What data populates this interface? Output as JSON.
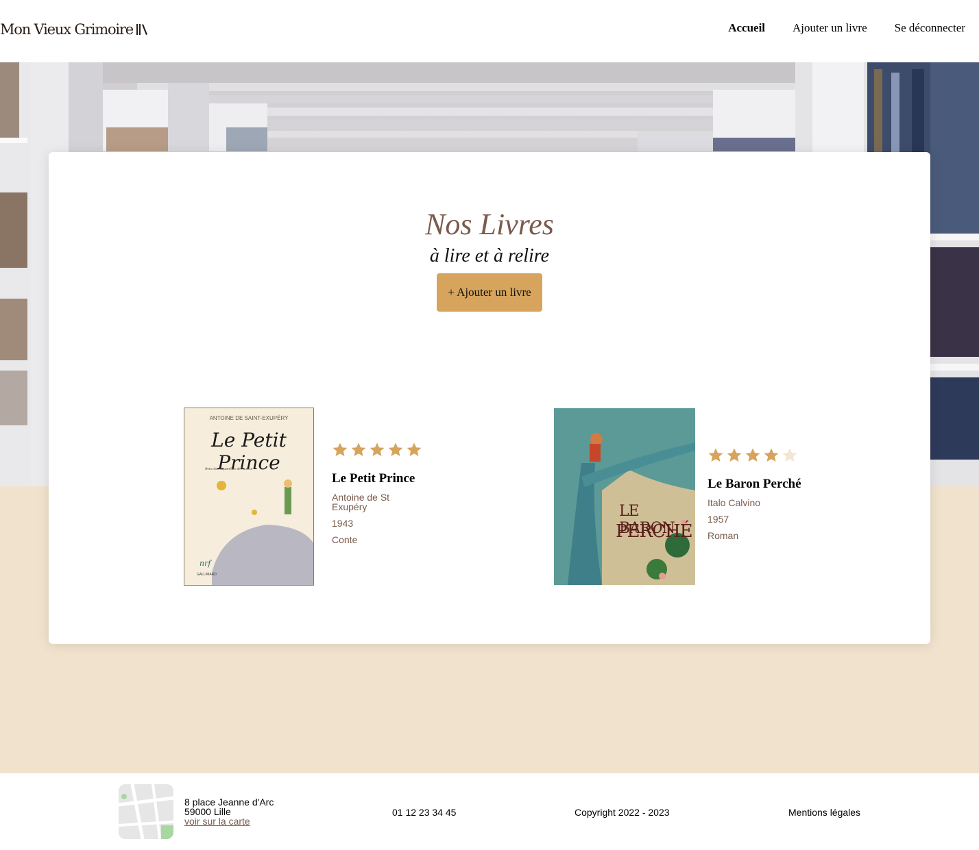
{
  "header": {
    "logo_text": "Mon Vieux Grimoire",
    "nav": [
      {
        "label": "Accueil",
        "active": true
      },
      {
        "label": "Ajouter un livre",
        "active": false
      },
      {
        "label": "Se déconnecter",
        "active": false
      }
    ]
  },
  "main": {
    "title": "Nos Livres",
    "subtitle": "à lire et à relire",
    "add_button": "+ Ajouter un livre",
    "books": [
      {
        "title": "Le Petit Prince",
        "author": "Antoine de St Exupéry",
        "year": "1943",
        "genre": "Conte",
        "rating": 5,
        "cover": {
          "author_line": "ANTOINE DE SAINT-EXUPÉRY",
          "title_line": "Le Petit Prince",
          "sub_line": "Avec des aquarelles de l'auteur",
          "publisher": "GALLIMARD",
          "mark": "nrf"
        }
      },
      {
        "title": "Le Baron Perché",
        "author": "Italo Calvino",
        "year": "1957",
        "genre": "Roman",
        "rating": 4,
        "cover": {
          "title_line_1": "LE BARON",
          "title_line_2": "PERCHÉ"
        }
      }
    ]
  },
  "footer": {
    "address_line1": "8 place Jeanne d'Arc",
    "address_line2": "59000 Lille",
    "map_link": "voir sur la carte",
    "phone": "01 12 23 34 45",
    "copyright": "Copyright 2022 - 2023",
    "legal": "Mentions légales"
  },
  "colors": {
    "accent": "#d6a45c",
    "brown": "#7a5b4d",
    "beige": "#f0e2cc",
    "star_empty": "#f2e5d2"
  },
  "icons": [
    "books-logo-icon",
    "star-icon",
    "map-thumbnail"
  ]
}
